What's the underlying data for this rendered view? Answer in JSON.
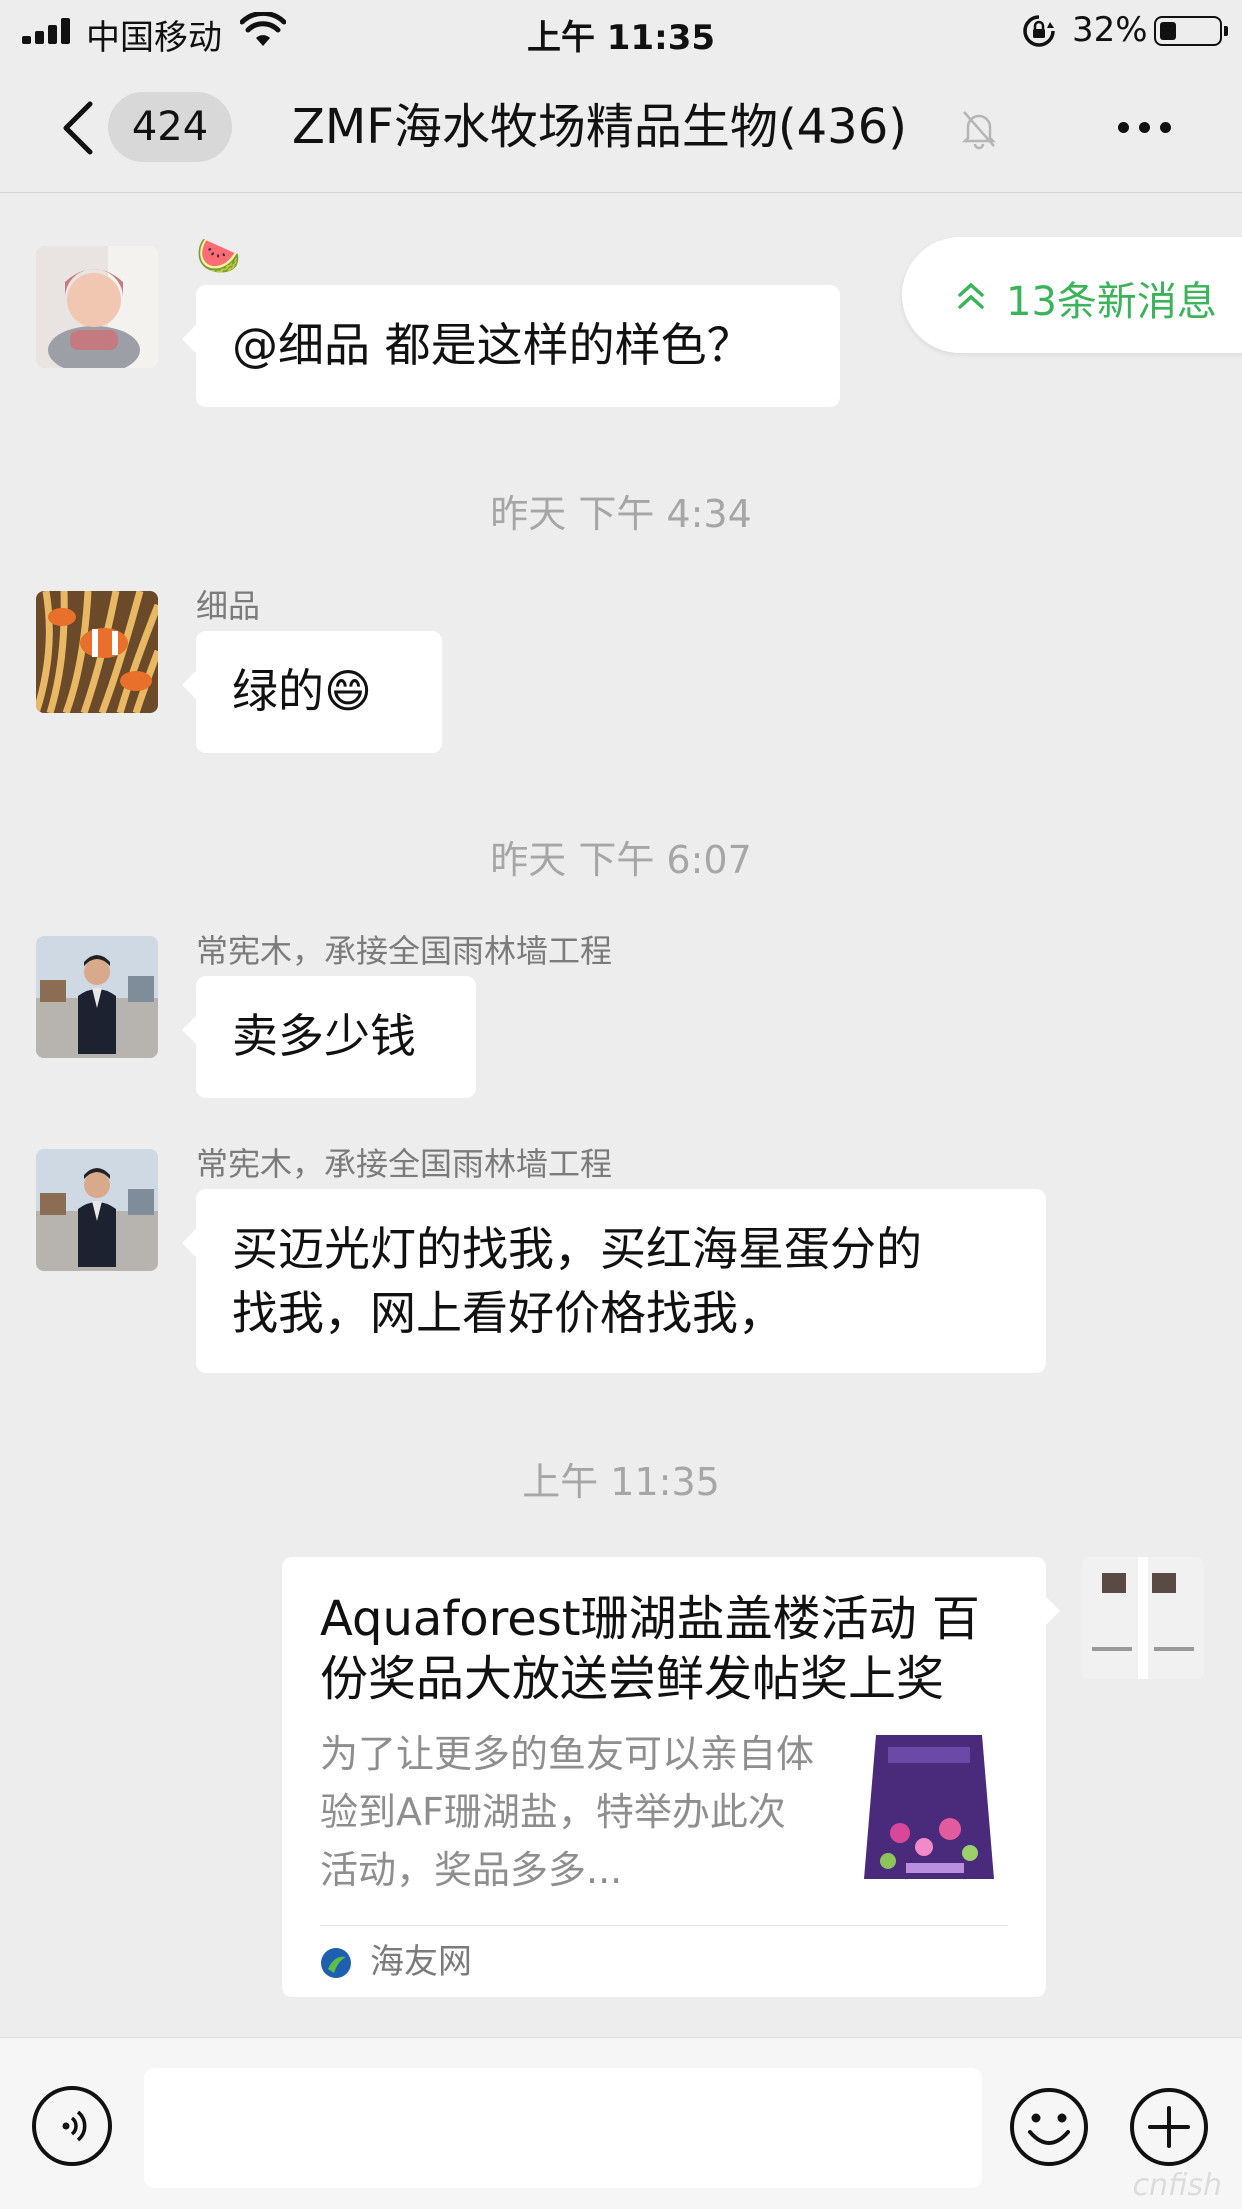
{
  "status_bar": {
    "carrier": "中国移动",
    "time": "上午 11:35",
    "battery": "32%"
  },
  "nav": {
    "unread_count": "424",
    "title": "ZMF海水牧场精品生物(436)"
  },
  "new_messages_pill": "13条新消息",
  "messages": [
    {
      "sender": "🍉",
      "text": "@细品 都是这样的样色？"
    },
    {
      "timestamp": "昨天 下午 4:34"
    },
    {
      "sender": "细品",
      "text": "绿的😄"
    },
    {
      "timestamp": "昨天 下午 6:07"
    },
    {
      "sender": "常宪木，承接全国雨林墙工程",
      "text": "卖多少钱"
    },
    {
      "sender": "常宪木，承接全国雨林墙工程",
      "text_lines": [
        "买迈光灯的找我，买红海星蛋分的",
        "找我，网上看好价格找我，"
      ]
    },
    {
      "timestamp": "上午 11:35"
    }
  ],
  "link_card": {
    "title": "Aquaforest珊湖盐盖楼活动 百份奖品大放送尝鲜发帖奖上奖",
    "description": "为了让更多的鱼友可以亲自体验到AF珊湖盐，特举办此次活动，奖品多多...",
    "source": "海友网"
  },
  "watermark": "cnfish"
}
